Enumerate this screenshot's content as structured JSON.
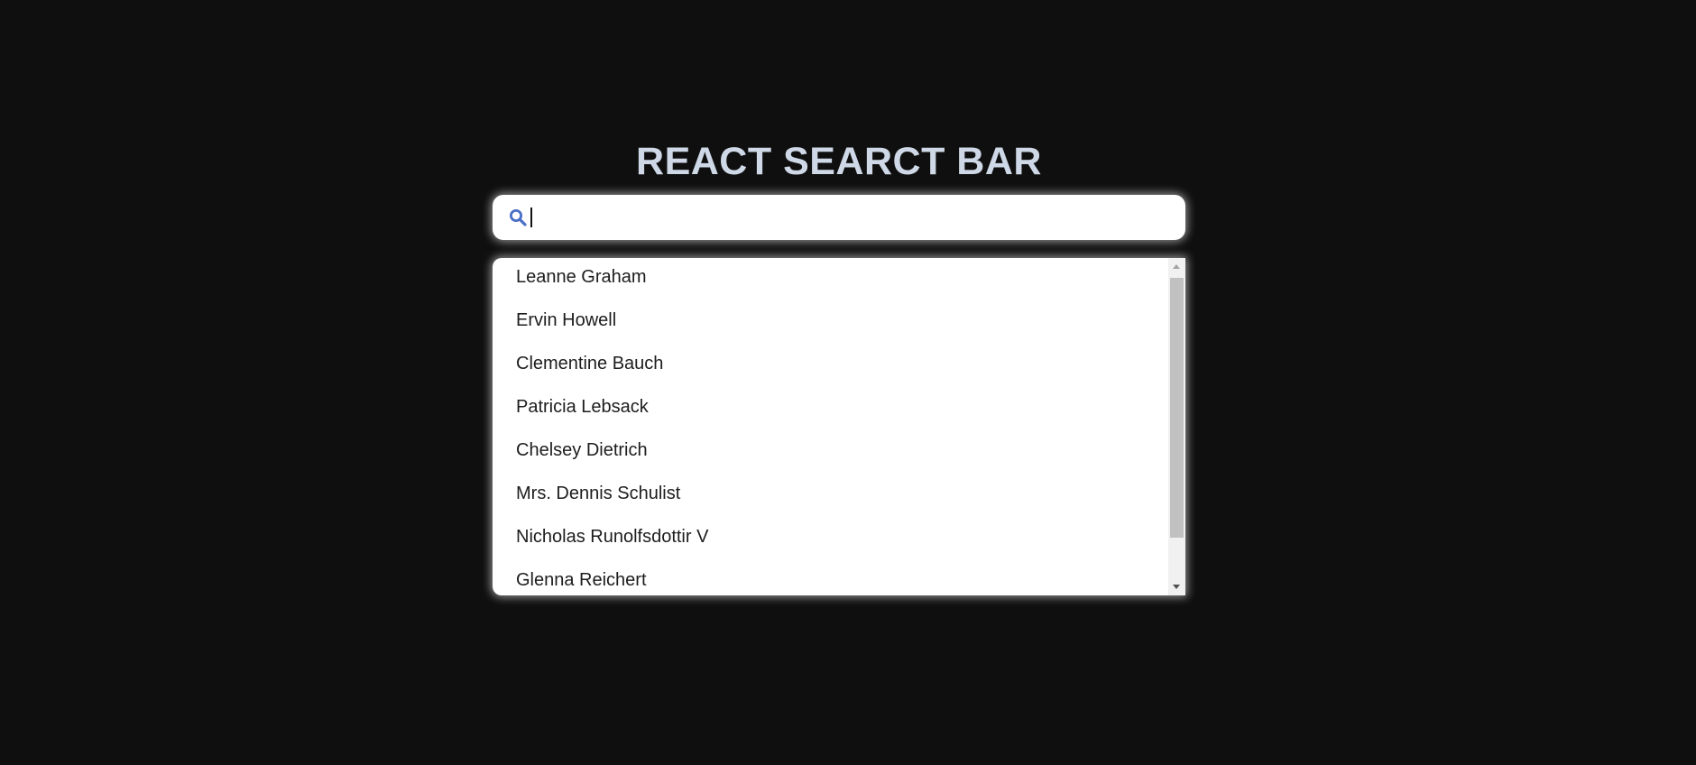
{
  "page": {
    "title": "REACT SEARCT BAR"
  },
  "search": {
    "icon": "search-icon",
    "value": "",
    "placeholder": ""
  },
  "results": {
    "items": [
      "Leanne Graham",
      "Ervin Howell",
      "Clementine Bauch",
      "Patricia Lebsack",
      "Chelsey Dietrich",
      "Mrs. Dennis Schulist",
      "Nicholas Runolfsdottir V",
      "Glenna Reichert"
    ]
  },
  "colors": {
    "background": "#0f0f0f",
    "title": "#cfd8e6",
    "icon": "#4a6fc7",
    "panel": "#ffffff"
  }
}
